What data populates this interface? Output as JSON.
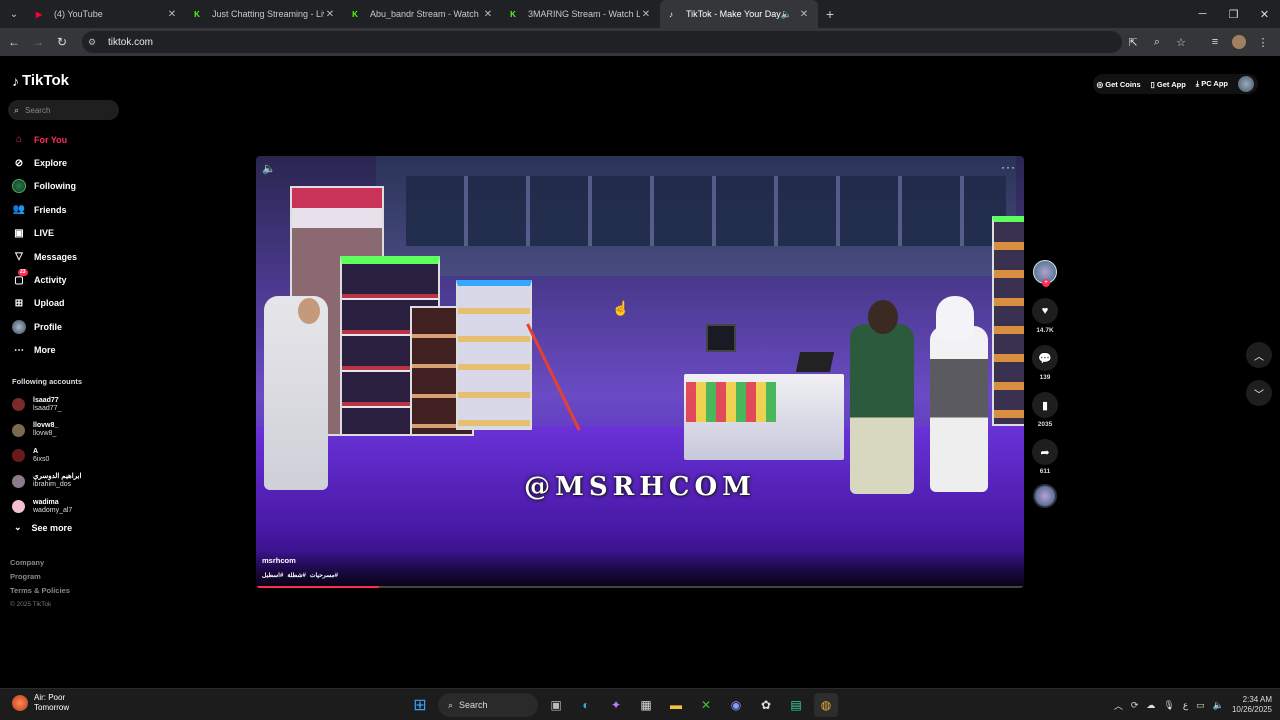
{
  "browser": {
    "tabs": [
      {
        "title": "(4) YouTube",
        "favicon": "youtube-icon",
        "color": "#ff0033"
      },
      {
        "title": "Just Chatting Streaming - Live",
        "favicon": "kick-icon",
        "color": "#53fc18"
      },
      {
        "title": "Abu_bandr Stream - Watch Live",
        "favicon": "kick-icon",
        "color": "#53fc18"
      },
      {
        "title": "3MARING Stream - Watch Live",
        "favicon": "kick-icon",
        "color": "#53fc18"
      },
      {
        "title": "TikTok - Make Your Day",
        "favicon": "tiktok-icon",
        "color": "#ffffff",
        "active": true
      }
    ],
    "url": "tiktok.com"
  },
  "tiktok": {
    "logo_text": "TikTok",
    "search_placeholder": "Search",
    "nav": [
      {
        "label": "For You",
        "icon": "home-icon",
        "active": true
      },
      {
        "label": "Explore",
        "icon": "compass-icon"
      },
      {
        "label": "Following",
        "icon": "following-avatar-icon"
      },
      {
        "label": "Friends",
        "icon": "friends-icon"
      },
      {
        "label": "LIVE",
        "icon": "live-icon"
      },
      {
        "label": "Messages",
        "icon": "send-icon"
      },
      {
        "label": "Activity",
        "icon": "activity-icon",
        "badge": "23"
      },
      {
        "label": "Upload",
        "icon": "upload-icon"
      },
      {
        "label": "Profile",
        "icon": "profile-avatar-icon"
      },
      {
        "label": "More",
        "icon": "more-icon"
      }
    ],
    "following_title": "Following accounts",
    "following": [
      {
        "name": "lsaad77",
        "handle": "lsaad77_",
        "color": "#7a2a2a"
      },
      {
        "name": "llovw8_",
        "handle": "llovw8_",
        "color": "#7a6a50"
      },
      {
        "name": "A",
        "handle": "6ixs0",
        "color": "#6a1a1a"
      },
      {
        "name": "ابراهيم الدوسري",
        "handle": "ibrahim_dos",
        "color": "#8a7a8a"
      },
      {
        "name": "wadima",
        "handle": "wadomy_al7",
        "color": "#f4c0d0"
      }
    ],
    "see_more": "See more",
    "footer": [
      "Company",
      "Program",
      "Terms & Policies"
    ],
    "copyright": "© 2025 TikTok",
    "top_actions": [
      "Get Coins",
      "Get App",
      "PC App"
    ]
  },
  "video": {
    "watermark": "@MSRHCOM",
    "author": "msrhcom",
    "tags": [
      "#مسرحيات",
      "#شطلة",
      "#اسطبل"
    ],
    "progress": 0.16,
    "likes": "14.7K",
    "comments": "139",
    "saves": "2035",
    "shares": "611"
  },
  "taskbar": {
    "weather_title": "Air: Poor",
    "weather_sub": "Tomorrow",
    "search_label": "Search",
    "time": "2:34 AM",
    "date": "10/26/2025"
  }
}
